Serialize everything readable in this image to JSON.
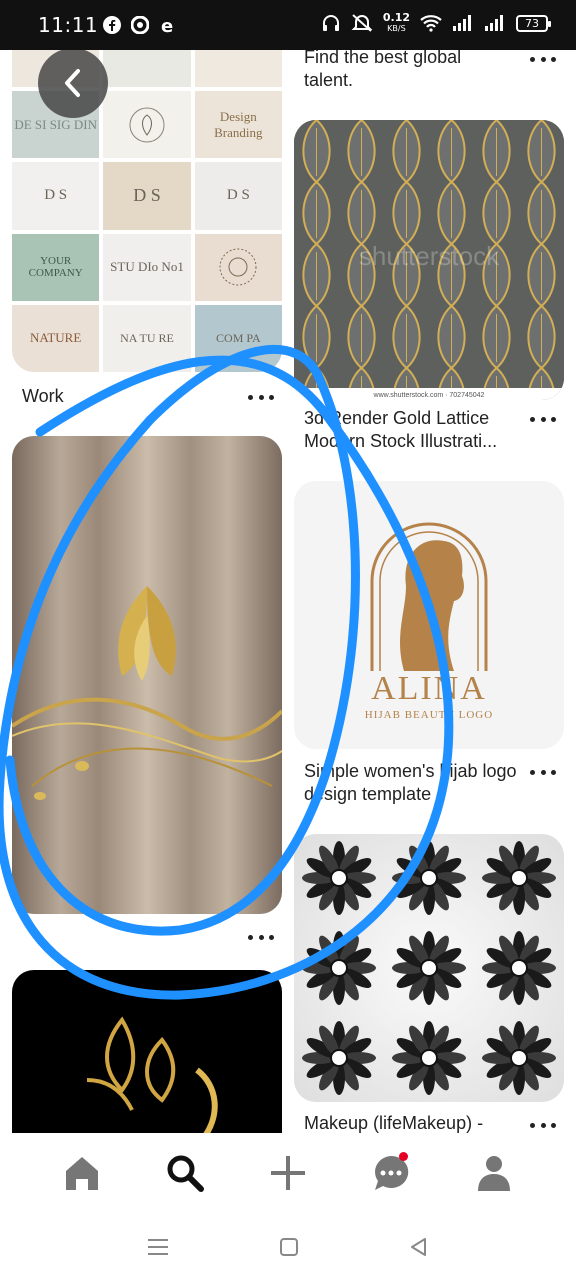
{
  "status_bar": {
    "time": "11:11",
    "net_speed_value": "0.12",
    "net_speed_unit": "KB/S",
    "battery": "73"
  },
  "feed": {
    "left_column": [
      {
        "title": "Work",
        "image": "logo-collection-grid",
        "grid_labels": [
          "DE SI SIG DIN",
          "",
          "Design Branding",
          "D S",
          "D S",
          "D S",
          "YOUR COMPANY",
          "STU DIo No1",
          "",
          "NATURE",
          "NA TU RE",
          "COM PA"
        ]
      },
      {
        "title": "",
        "image": "gold-leaf-curtain-wallpaper"
      },
      {
        "title": "",
        "image": "gold-woman-leaf-logo"
      }
    ],
    "right_column": [
      {
        "title": "Find the best global talent.",
        "image": ""
      },
      {
        "title": "3d Render Gold Lattice Modern Stock Illustrati...",
        "image": "gold-lattice-pattern",
        "watermark": "shutterstock",
        "caption": "www.shutterstock.com · 702745042"
      },
      {
        "title": "Simple women's hijab logo design template",
        "image": "hijab-beauty-logo",
        "logo_text": "ALINA",
        "logo_sub": "HIJAB BEAUTY LOGO"
      },
      {
        "title": "Makeup (lifeMakeup) -",
        "image": "mandala-flower-set"
      }
    ]
  },
  "bottom_nav": {
    "items": [
      "home-icon",
      "search-icon",
      "add-icon",
      "messages-icon",
      "profile-icon"
    ],
    "active": "search-icon"
  },
  "system_nav": [
    "menu-icon",
    "home-square-icon",
    "back-triangle-icon"
  ],
  "colors": {
    "annotation_blue": "#1e90ff",
    "notification_red": "#e60023",
    "gold": "#c9a44a"
  }
}
